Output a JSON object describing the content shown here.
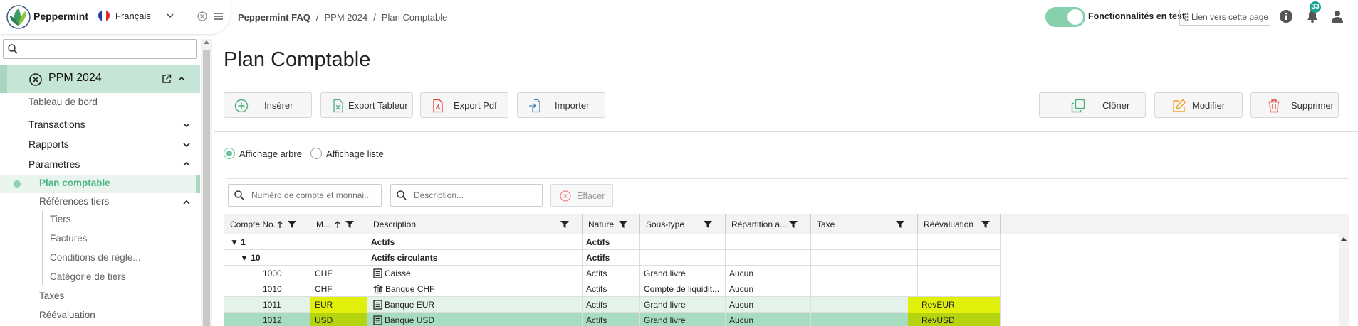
{
  "app": {
    "brand": "Peppermint",
    "language": "Français"
  },
  "breadcrumb": [
    "Peppermint FAQ",
    "PPM 2024",
    "Plan Comptable"
  ],
  "header": {
    "feature_toggle_label": "Fonctionnalités en test",
    "feature_toggle_on": true,
    "link_label": "Lien vers cette page",
    "notification_count": "33"
  },
  "sidebar": {
    "search_value": "",
    "project_title": "PPM 2024",
    "items": [
      {
        "label": "Tableau de bord"
      },
      {
        "label": "Transactions"
      },
      {
        "label": "Rapports"
      },
      {
        "label": "Paramètres"
      },
      {
        "label": "Plan comptable"
      },
      {
        "label": "Références tiers"
      },
      {
        "label": "Tiers"
      },
      {
        "label": "Factures"
      },
      {
        "label": "Conditions de règle..."
      },
      {
        "label": "Catégorie de tiers"
      },
      {
        "label": "Taxes"
      },
      {
        "label": "Réévaluation"
      }
    ]
  },
  "page": {
    "title": "Plan Comptable"
  },
  "toolbar": {
    "insert": "Insérer",
    "export_sheet": "Export Tableur",
    "export_pdf": "Export Pdf",
    "import": "Importer",
    "clone": "Clôner",
    "modify": "Modifier",
    "delete": "Supprimer"
  },
  "view": {
    "tree": "Affichage arbre",
    "list": "Affichage liste",
    "selected": "tree"
  },
  "filters": {
    "account_placeholder": "Numéro de compte et monnai...",
    "description_placeholder": "Description...",
    "clear": "Effacer"
  },
  "grid": {
    "columns": [
      "Compte No.",
      "M...",
      "Description",
      "Nature",
      "Sous-type",
      "Répartition a...",
      "Taxe",
      "Réévaluation"
    ],
    "rows": [
      {
        "account": "1",
        "currency": "",
        "description": "Actifs",
        "nature": "Actifs",
        "subtype": "",
        "allocation": "",
        "tax": "",
        "reval": ""
      },
      {
        "account": "10",
        "currency": "",
        "description": "Actifs circulants",
        "nature": "Actifs",
        "subtype": "",
        "allocation": "",
        "tax": "",
        "reval": ""
      },
      {
        "account": "1000",
        "currency": "CHF",
        "description": "Caisse",
        "nature": "Actifs",
        "subtype": "Grand livre",
        "allocation": "Aucun",
        "tax": "",
        "reval": ""
      },
      {
        "account": "1010",
        "currency": "CHF",
        "description": "Banque CHF",
        "nature": "Actifs",
        "subtype": "Compte de liquidit...",
        "allocation": "Aucun",
        "tax": "",
        "reval": ""
      },
      {
        "account": "1011",
        "currency": "EUR",
        "description": "Banque EUR",
        "nature": "Actifs",
        "subtype": "Grand livre",
        "allocation": "Aucun",
        "tax": "",
        "reval": "RevEUR"
      },
      {
        "account": "1012",
        "currency": "USD",
        "description": "Banque USD",
        "nature": "Actifs",
        "subtype": "Grand livre",
        "allocation": "Aucun",
        "tax": "",
        "reval": "RevUSD"
      }
    ]
  },
  "colors": {
    "accent": "#86d1ab",
    "sidebar_active": "#c5e6d6",
    "highlight_yellow": "#e1f00a",
    "selected_row": "#a8dcc1",
    "selected_cell": "#b3d40f",
    "badge": "#1aa394"
  }
}
